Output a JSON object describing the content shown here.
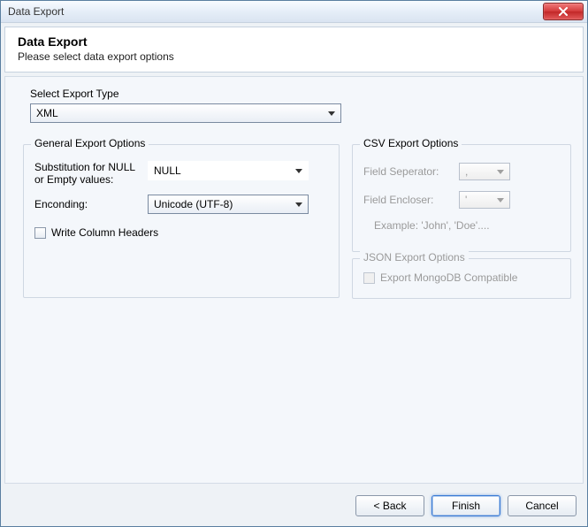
{
  "window": {
    "title": "Data Export"
  },
  "header": {
    "title": "Data Export",
    "subtitle": "Please select data export options"
  },
  "exportType": {
    "label": "Select Export Type",
    "value": "XML"
  },
  "general": {
    "legend": "General Export Options",
    "nullSub": {
      "label": "Substitution for NULL or Empty values:",
      "value": "NULL"
    },
    "encoding": {
      "label": "Enconding:",
      "value": "Unicode (UTF-8)"
    },
    "writeHeaders": {
      "label": "Write Column Headers",
      "checked": false
    }
  },
  "csv": {
    "legend": "CSV Export Options",
    "separator": {
      "label": "Field Seperator:",
      "value": ","
    },
    "encloser": {
      "label": "Field Encloser:",
      "value": "'"
    },
    "example": "Example: 'John', 'Doe'...."
  },
  "json": {
    "legend": "JSON Export Options",
    "mongo": {
      "label": "Export MongoDB Compatible",
      "checked": false
    }
  },
  "footer": {
    "back": "< Back",
    "finish": "Finish",
    "cancel": "Cancel"
  }
}
